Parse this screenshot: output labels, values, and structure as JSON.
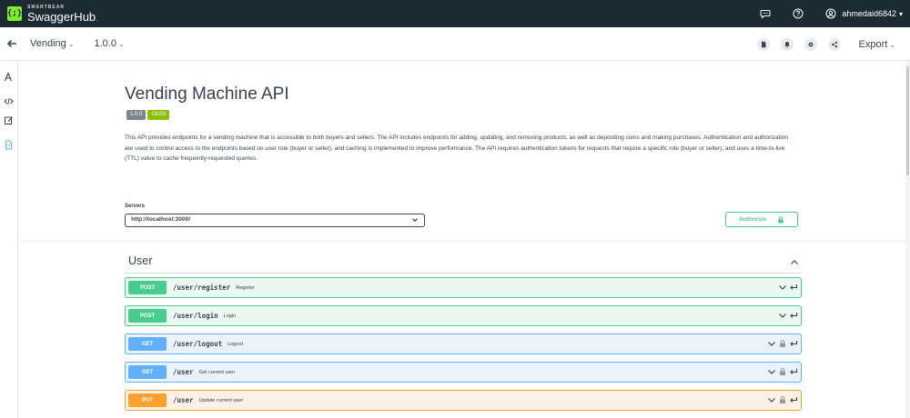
{
  "topbar": {
    "brand_sub": "SMARTBEAR",
    "brand_main": "SwaggerHub",
    "brand_suffix": ".",
    "logo_glyph": "{;}",
    "user": "ahmedaid6842",
    "icons": [
      "chat-icon",
      "help-icon",
      "user-icon"
    ]
  },
  "subbar": {
    "api_name": "Vending",
    "version": "1.0.0",
    "export_label": "Export",
    "icons": [
      "document-icon",
      "bell-icon",
      "gear-icon",
      "share-icon"
    ]
  },
  "info": {
    "title": "Vending Machine API",
    "version_badge": "1.0.0",
    "oas_badge": "OAS3",
    "description": "This API provides endpoints for a vending machine that is accessible to both buyers and sellers. The API includes endpoints for adding, updating, and removing products, as well as depositing coins and making purchases. Authentication and authorization are used to control access to the endpoints based on user role (buyer or seller), and caching is implemented to improve performance. The API requires authentication tokens for requests that require a specific role (buyer or seller), and uses a time-to-live (TTL) value to cache frequently-requested queries."
  },
  "servers": {
    "label": "Servers",
    "selected": "http://localhost:3000/"
  },
  "authorize": {
    "label": "Authorize"
  },
  "tag": {
    "name": "User"
  },
  "operations": [
    {
      "method": "POST",
      "path": "/user/register",
      "summary": "Register",
      "locked": false
    },
    {
      "method": "POST",
      "path": "/user/login",
      "summary": "Login",
      "locked": false
    },
    {
      "method": "GET",
      "path": "/user/logout",
      "summary": "Logout",
      "locked": true
    },
    {
      "method": "GET",
      "path": "/user",
      "summary": "Get current user",
      "locked": true
    },
    {
      "method": "PUT",
      "path": "/user",
      "summary": "Update current user",
      "locked": true
    }
  ],
  "colors": {
    "topbar": "#1b2a33",
    "post": "#49cc90",
    "get": "#61affe",
    "put": "#fca130",
    "logo": "#85ea2d"
  }
}
